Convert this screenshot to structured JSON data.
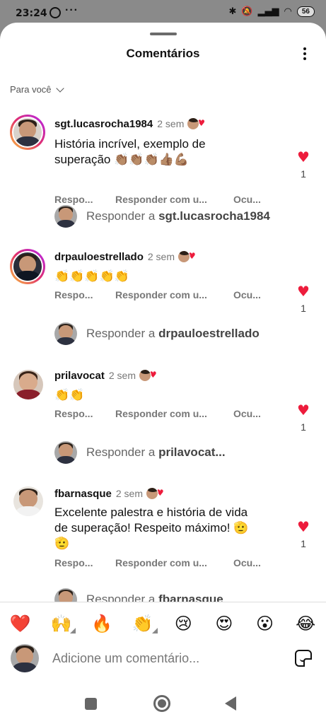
{
  "status_bar": {
    "time": "23:24",
    "dots": "···",
    "battery": "56"
  },
  "sheet": {
    "title": "Comentários",
    "sort_label": "Para você"
  },
  "comments": [
    {
      "username": "sgt.lucasrocha1984",
      "time": "2 sem",
      "text": "História incrível, exemplo de superação 👏🏽👏🏽👏🏽👍🏽💪🏽",
      "actions": [
        "Respo...",
        "Responder com u...",
        "Ocu..."
      ],
      "likes": "1",
      "reply": {
        "prefix": "Responder a ",
        "name": "sgt.lucasrocha1984"
      }
    },
    {
      "username": "drpauloestrellado",
      "time": "2 sem",
      "text": "👏👏👏👏👏",
      "actions": [
        "Respo...",
        "Responder com u...",
        "Ocu..."
      ],
      "likes": "1",
      "reply": {
        "prefix": "Responder a ",
        "name": "drpauloestrellado"
      }
    },
    {
      "username": "prilavocat",
      "time": "2 sem",
      "text": "👏👏",
      "actions": [
        "Respo...",
        "Responder com u...",
        "Ocu..."
      ],
      "likes": "1",
      "reply": {
        "prefix": "Responder a ",
        "name": "prilavocat..."
      }
    },
    {
      "username": "fbarnasque",
      "time": "2 sem",
      "text": "Excelente palestra e história de vida de superação! Respeito máximo! 🫡🫡",
      "actions": [
        "Respo...",
        "Responder com u...",
        "Ocu..."
      ],
      "likes": "1",
      "reply": {
        "prefix": "Responder a ",
        "name": "fbarnasque"
      }
    }
  ],
  "emoji_bar": [
    "❤️",
    "🙌",
    "🔥",
    "👏",
    "😢",
    "😍",
    "😮",
    "😂"
  ],
  "composer": {
    "placeholder": "Adicione um comentário..."
  },
  "colors": {
    "heart": "#ed1c3c",
    "muted": "#777777"
  }
}
